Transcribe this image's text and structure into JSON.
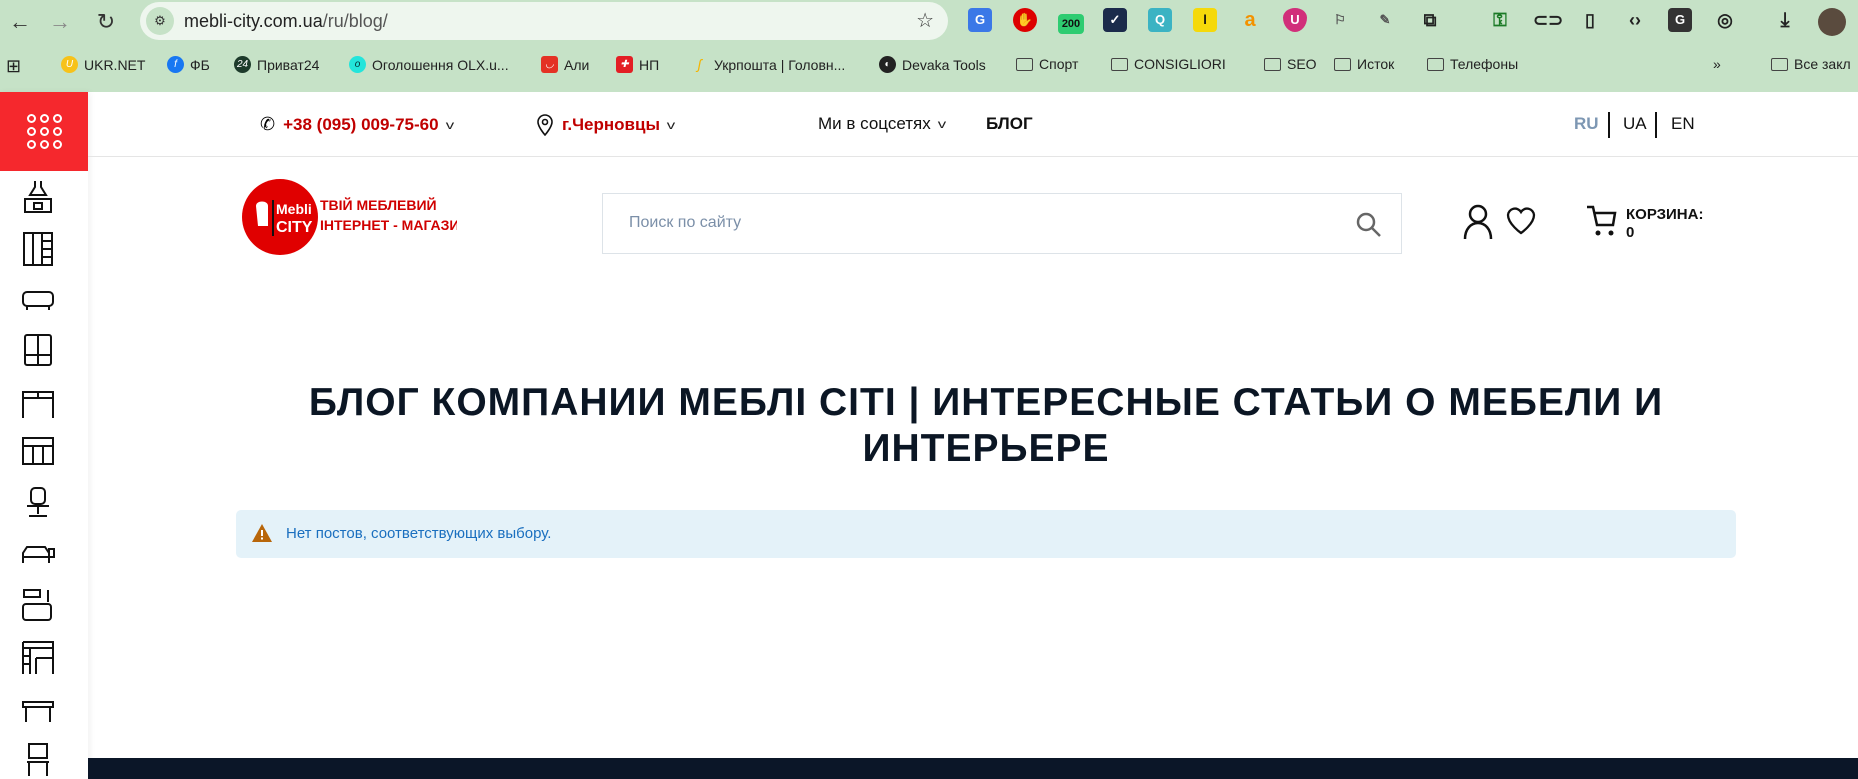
{
  "browser": {
    "url_host": "mebli-city.com.ua",
    "url_path": "/ru/blog/",
    "extension_badge": "200",
    "bookmarks": [
      {
        "label": "UKR.NET"
      },
      {
        "label": "ФБ"
      },
      {
        "label": "Приват24"
      },
      {
        "label": "Оголошення OLX.u..."
      },
      {
        "label": "Али"
      },
      {
        "label": "НП"
      },
      {
        "label": "Укрпошта | Головн..."
      },
      {
        "label": "Devaka Tools"
      },
      {
        "label": "Спорт"
      },
      {
        "label": "CONSIGLIORI"
      },
      {
        "label": "SEO"
      },
      {
        "label": "Исток"
      },
      {
        "label": "Телефоны"
      }
    ],
    "more_bookmarks": "»",
    "all_bookmarks": "Все закл"
  },
  "topbar": {
    "phone": "+38 (095) 009-75-60",
    "city": "г.Черновцы",
    "socials": "Ми в соцсетях",
    "blog": "БЛОГ",
    "languages": [
      "RU",
      "UA",
      "EN"
    ],
    "active_language": "RU"
  },
  "header": {
    "logo_text": "Mebli CITY ТВІЙ МЕБЛЕВИЙ ІНТЕРНЕТ - МАГАЗИН",
    "search_placeholder": "Поиск по сайту",
    "cart_label": "КОРЗИНА:",
    "cart_count": "0"
  },
  "main": {
    "title": "БЛОГ КОМПАНИИ МЕБЛІ СІТІ | ИНТЕРЕСНЫЕ СТАТЬИ О МЕБЕЛИ И ИНТЕРЬЕРЕ",
    "notice": "Нет постов, соответствующих выбору."
  },
  "colors": {
    "brand_red": "#f5282d",
    "accent_red": "#c00000",
    "chrome_green": "#c6e2c7",
    "notice_bg": "#e4f2f9"
  }
}
